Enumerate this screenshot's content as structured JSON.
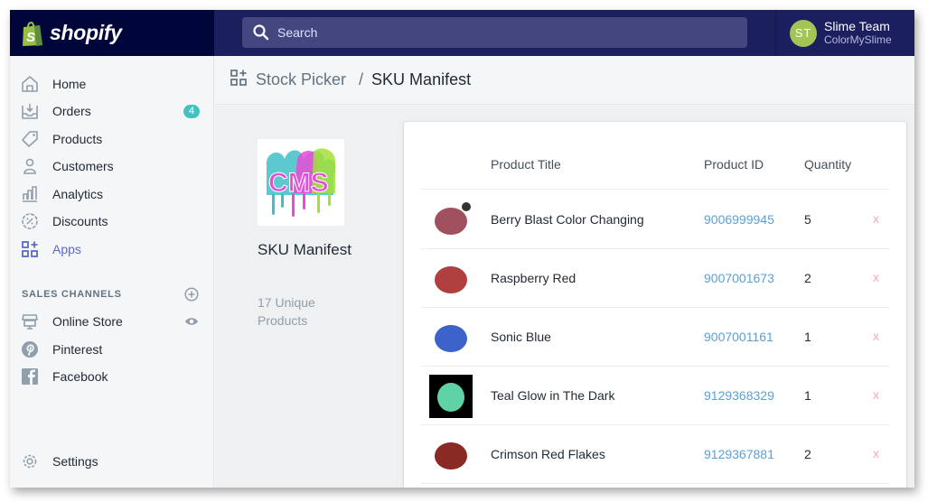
{
  "topbar": {
    "brand": "shopify",
    "search_placeholder": "Search",
    "user": {
      "initials": "ST",
      "name": "Slime Team",
      "shop": "ColorMySlime",
      "avatar_color": "#a3c556"
    }
  },
  "sidebar": {
    "items": [
      {
        "label": "Home",
        "icon": "home-icon"
      },
      {
        "label": "Orders",
        "icon": "orders-icon",
        "badge": "4"
      },
      {
        "label": "Products",
        "icon": "tag-icon"
      },
      {
        "label": "Customers",
        "icon": "person-icon"
      },
      {
        "label": "Analytics",
        "icon": "analytics-icon"
      },
      {
        "label": "Discounts",
        "icon": "discount-icon"
      },
      {
        "label": "Apps",
        "icon": "apps-icon",
        "active": true
      }
    ],
    "sales_channels_title": "SALES CHANNELS",
    "channels": [
      {
        "label": "Online Store",
        "icon": "store-icon"
      },
      {
        "label": "Pinterest",
        "icon": "pinterest-icon"
      },
      {
        "label": "Facebook",
        "icon": "facebook-icon"
      }
    ],
    "settings": {
      "label": "Settings",
      "icon": "gear-icon"
    }
  },
  "breadcrumb": {
    "parent": "Stock Picker",
    "separator": "/",
    "current": "SKU Manifest"
  },
  "panel": {
    "title": "SKU Manifest",
    "count_text": "17 Unique Products"
  },
  "table": {
    "headers": [
      "Product Title",
      "Product ID",
      "Quantity"
    ],
    "delete_label": "x",
    "rows": [
      {
        "title": "Berry Blast Color Changing",
        "id": "9006999945",
        "qty": "5",
        "color": "#a0505e"
      },
      {
        "title": "Raspberry Red",
        "id": "9007001673",
        "qty": "2",
        "color": "#b0403f"
      },
      {
        "title": "Sonic Blue",
        "id": "9007001161",
        "qty": "1",
        "color": "#3c63c9"
      },
      {
        "title": "Teal Glow in The Dark",
        "id": "9129368329",
        "qty": "1",
        "color": "#5fd3a6"
      },
      {
        "title": "Crimson Red Flakes",
        "id": "9129367881",
        "qty": "2",
        "color": "#8a2a25"
      }
    ]
  },
  "colors": {
    "nav_dark": "#000639",
    "topbar": "#1c1f5e",
    "accent": "#5c6ac4",
    "link": "#5a9fd6",
    "badge": "#47c1bf"
  }
}
